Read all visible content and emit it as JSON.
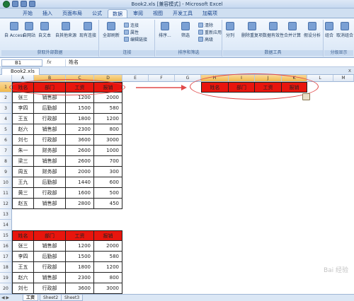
{
  "window": {
    "title": "Book2.xls [兼容模式] - Microsoft Excel"
  },
  "ribbon": {
    "tabs": [
      "开始",
      "插入",
      "页面布局",
      "公式",
      "数据",
      "审阅",
      "视图",
      "开发工具",
      "加载项"
    ],
    "active_tab": "数据",
    "groups": [
      {
        "name": "获取外部数据",
        "buttons": [
          "自 Access",
          "自网站",
          "自文本",
          "自其他来源",
          "现有连接"
        ]
      },
      {
        "name": "连接",
        "buttons": [
          "全部刷新",
          "连接",
          "属性",
          "编辑链接"
        ]
      },
      {
        "name": "排序和筛选",
        "buttons": [
          "排序...",
          "筛选",
          "清除",
          "重新应用",
          "高级"
        ]
      },
      {
        "name": "数据工具",
        "buttons": [
          "分列",
          "删除重复项",
          "数据有效性",
          "合并计算",
          "假设分析"
        ]
      },
      {
        "name": "分级显示",
        "buttons": [
          "组合",
          "取消组合",
          "分"
        ]
      }
    ]
  },
  "formula_bar": {
    "name_box": "B1",
    "fx": "fx",
    "value": "姓名"
  },
  "workbook_tab": {
    "label": "Book2.xls",
    "close": "x"
  },
  "columns": [
    "A",
    "B",
    "C",
    "D",
    "E",
    "F",
    "G",
    "H",
    "I",
    "J",
    "K",
    "L",
    "M"
  ],
  "rows": [
    "1",
    "2",
    "3",
    "4",
    "5",
    "6",
    "7",
    "8",
    "9",
    "10",
    "11",
    "12",
    "13",
    "14",
    "15",
    "16",
    "17",
    "18",
    "19",
    "20"
  ],
  "table1": {
    "headers": [
      "姓名",
      "部门",
      "工资",
      "报销"
    ],
    "rows": [
      [
        "张三",
        "销售部",
        "1200",
        "2000"
      ],
      [
        "李四",
        "后勤部",
        "1500",
        "580"
      ],
      [
        "王五",
        "行政部",
        "1800",
        "1200"
      ],
      [
        "赵六",
        "销售部",
        "2300",
        "800"
      ],
      [
        "刘七",
        "行政部",
        "3600",
        "3000"
      ],
      [
        "朱一",
        "财务部",
        "2600",
        "1000"
      ],
      [
        "梁三",
        "销售部",
        "2600",
        "700"
      ],
      [
        "周五",
        "财务部",
        "2000",
        "300"
      ],
      [
        "王九",
        "后勤部",
        "1440",
        "600"
      ],
      [
        "黄三",
        "行政部",
        "1600",
        "500"
      ],
      [
        "赵五",
        "销售部",
        "2800",
        "450"
      ]
    ]
  },
  "pasted_header": [
    "姓名",
    "部门",
    "工资",
    "报销"
  ],
  "table2": {
    "headers": [
      "姓名",
      "部门",
      "工资",
      "报销"
    ],
    "rows": [
      [
        "张三",
        "销售部",
        "1200",
        "2000"
      ],
      [
        "李四",
        "后勤部",
        "1500",
        "580"
      ],
      [
        "王五",
        "行政部",
        "1800",
        "1200"
      ],
      [
        "赵六",
        "销售部",
        "2300",
        "800"
      ],
      [
        "刘七",
        "行政部",
        "3600",
        "3000"
      ]
    ]
  },
  "sheet_tabs": [
    "工资",
    "Sheet2",
    "Sheet3"
  ],
  "active_sheet": "工资",
  "watermark": "Bai 经验",
  "colors": {
    "header_red": "#e8150d",
    "highlight_circle": "#e14a4a",
    "ribbon_blue": "#d8e6f6"
  }
}
